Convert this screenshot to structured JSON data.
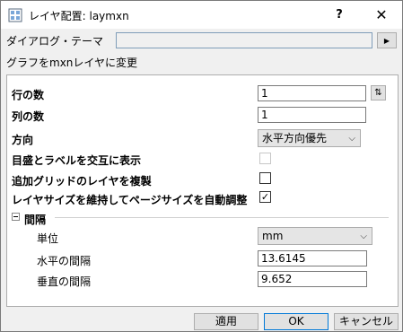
{
  "window": {
    "title": "レイヤ配置: laymxn",
    "help_label": "?",
    "close_label": "✕"
  },
  "theme": {
    "label": "ダイアログ・テーマ",
    "value": "",
    "arrow": "▶"
  },
  "description": "グラフをmxnレイヤに変更",
  "form": {
    "rows_label": "行の数",
    "rows_value": "1",
    "swap_icon": "⇅",
    "cols_label": "列の数",
    "cols_value": "1",
    "direction_label": "方向",
    "direction_value": "水平方向優先",
    "alternate_ticks_label": "目盛とラベルを交互に表示",
    "alternate_ticks_checked": false,
    "add_grid_label": "追加グリッドのレイヤを複製",
    "add_grid_checked": false,
    "keep_size_label": "レイヤサイズを維持してページサイズを自動調整",
    "keep_size_checked": true,
    "keep_size_check": "✓",
    "spacing_group": "間隔",
    "unit_label": "単位",
    "unit_value": "mm",
    "h_gap_label": "水平の間隔",
    "h_gap_value": "13.6145",
    "v_gap_label": "垂直の間隔",
    "v_gap_value": "9.652"
  },
  "buttons": {
    "apply": "適用",
    "ok": "OK",
    "cancel": "キャンセル"
  }
}
